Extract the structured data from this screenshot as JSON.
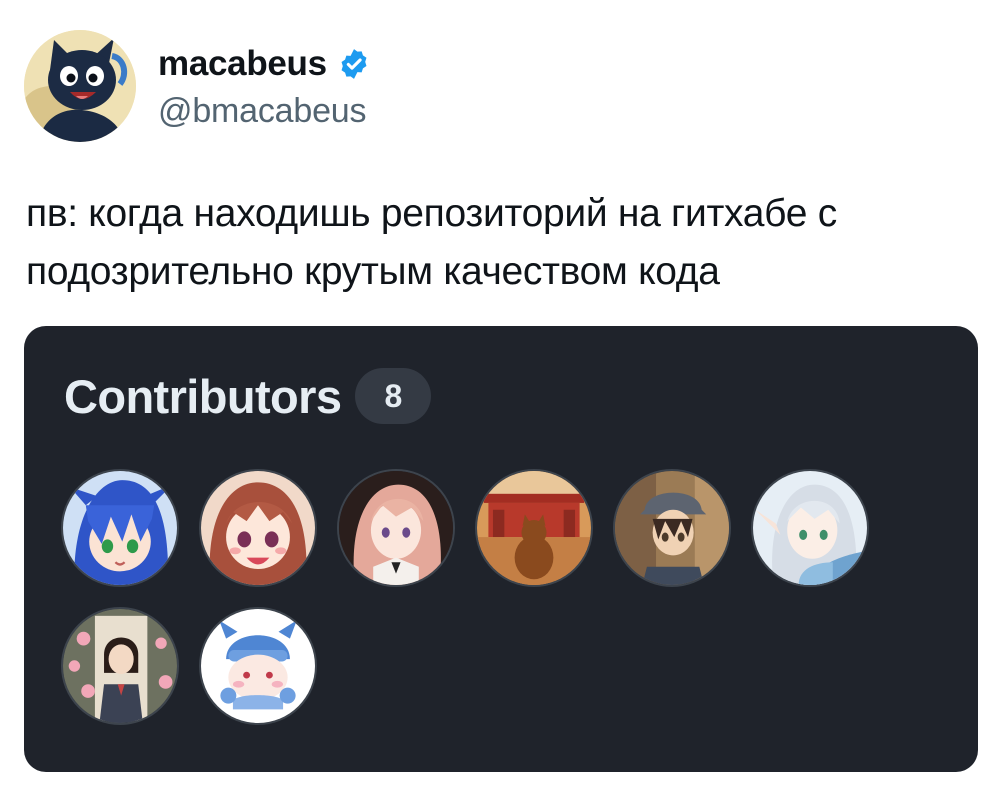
{
  "author": {
    "display_name": "macabeus",
    "handle": "@bmacabeus",
    "avatar_icon": "cartoon-cat-avatar-icon",
    "verified_icon": "verified-badge-icon"
  },
  "post": {
    "lines": [
      "пв: когда находишь репозиторий на гитхабе с",
      "подозрительно крутым качеством кода"
    ]
  },
  "card": {
    "title": "Contributors",
    "count": "8",
    "contributors": [
      {
        "icon": "anime-blue-hair-avatar-icon",
        "accent": "#3c63d8"
      },
      {
        "icon": "anime-red-hair-avatar-icon",
        "accent": "#b25a43"
      },
      {
        "icon": "anime-pink-hair-avatar-icon",
        "accent": "#e6b0a2"
      },
      {
        "icon": "cat-at-temple-avatar-icon",
        "accent": "#c98a3a"
      },
      {
        "icon": "anime-boy-cap-avatar-icon",
        "accent": "#6b5a44"
      },
      {
        "icon": "anime-elf-avatar-icon",
        "accent": "#8fb8d8"
      },
      {
        "icon": "anime-girl-portrait-avatar-icon",
        "accent": "#4a5a4a"
      },
      {
        "icon": "chibi-blue-hat-avatar-icon",
        "accent": "#5b8ed6"
      }
    ]
  },
  "colors": {
    "text_primary": "#0f1419",
    "text_secondary": "#536471",
    "verified_blue": "#1d9bf0",
    "card_background": "#1f232b",
    "card_text": "#e6edf3",
    "counter_background": "#343a44"
  }
}
